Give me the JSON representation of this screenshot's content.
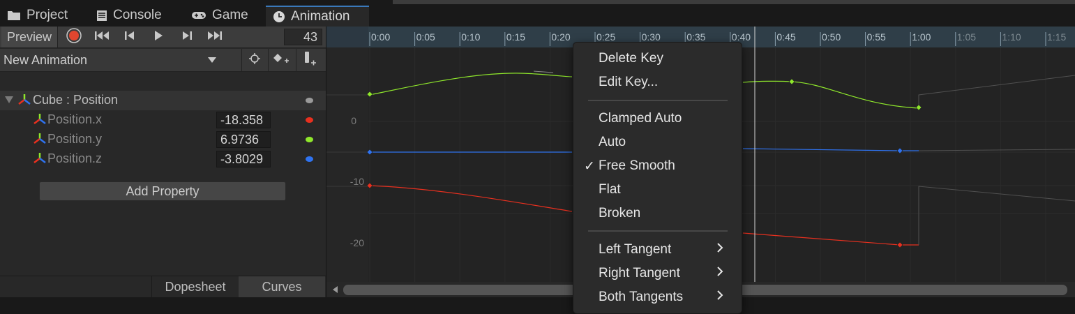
{
  "tabs": [
    {
      "label": "Project",
      "icon": "folder-icon"
    },
    {
      "label": "Console",
      "icon": "console-icon"
    },
    {
      "label": "Game",
      "icon": "gamepad-icon"
    },
    {
      "label": "Animation",
      "icon": "clock-icon",
      "active": true
    }
  ],
  "toolbar": {
    "preview_label": "Preview",
    "frame": "43",
    "buttons": [
      "record-icon",
      "first-key-icon",
      "prev-key-icon",
      "play-icon",
      "next-key-icon",
      "last-key-icon"
    ]
  },
  "clip": {
    "name": "New Animation",
    "buttons": [
      "snap-target-icon",
      "add-keyframe-icon",
      "add-event-icon"
    ]
  },
  "properties": {
    "group": "Cube : Position",
    "items": [
      {
        "label": "Position.x",
        "value": "-18.358",
        "color": "#e8301f"
      },
      {
        "label": "Position.y",
        "value": "6.9736",
        "color": "#8fe82b"
      },
      {
        "label": "Position.z",
        "value": "-3.8029",
        "color": "#2f73f0"
      }
    ],
    "add_property": "Add Property"
  },
  "bottom_tabs": {
    "dopesheet": "Dopesheet",
    "curves": "Curves"
  },
  "timeline": {
    "ticks": [
      "0:00",
      "0:05",
      "0:10",
      "0:15",
      "0:20",
      "0:25",
      "0:30",
      "0:35",
      "0:40",
      "0:45",
      "0:50",
      "0:55",
      "1:00",
      "1:05",
      "1:10",
      "1:15"
    ],
    "y_labels": [
      "0",
      "-10",
      "-20"
    ]
  },
  "menu": {
    "items": [
      {
        "label": "Delete Key"
      },
      {
        "label": "Edit Key..."
      },
      {
        "label": "Clamped Auto"
      },
      {
        "label": "Auto"
      },
      {
        "label": "Free Smooth",
        "checked": true
      },
      {
        "label": "Flat"
      },
      {
        "label": "Broken"
      },
      {
        "label": "Left Tangent",
        "submenu": true
      },
      {
        "label": "Right Tangent",
        "submenu": true
      },
      {
        "label": "Both Tangents",
        "submenu": true
      }
    ],
    "check_glyph": "✓",
    "submenu_glyph": "›"
  },
  "colors": {
    "accent": "#3a79bb",
    "record": "#e0462f",
    "x": "#e8301f",
    "y": "#8fe82b",
    "z": "#2f73f0"
  }
}
